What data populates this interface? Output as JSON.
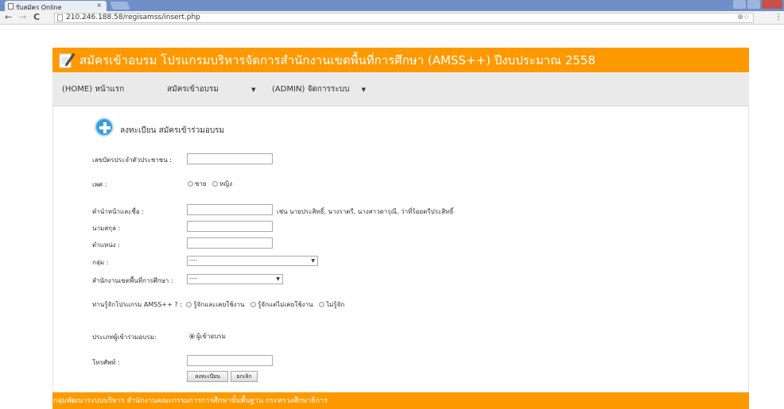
{
  "browser": {
    "tab_title": "รับสมัคร Online",
    "tab_close": "×",
    "url": "210.246.188.58/regisamss/insert.php",
    "back": "←",
    "forward": "→",
    "reload": "C",
    "zoom_star": "⊕☆",
    "menu": "⋮"
  },
  "banner": {
    "title": "สมัครเข้าอบรม โปรแกรมบริหารจัดการสำนักงานเขตพื้นที่การศึกษา (AMSS++) ปีงบประมาณ 2558"
  },
  "nav": {
    "home": "(HOME) หน้าแรก",
    "register": "สมัครเข้าอบรม",
    "admin": "(ADMIN) จัดการระบบ",
    "caret": "▼"
  },
  "form": {
    "heading": "ลงทะเบียน สมัครเข้าร่วมอบรม",
    "id_label": "เลขบัตรประจำตัวประชาชน :",
    "sex_label": "เพศ :",
    "sex_male": "ชาย",
    "sex_female": "หญิง",
    "name_label": "คำนำหน้าและชื่อ :",
    "name_hint": "เช่น นายประสิทธิ์, นางราตรี, นางสาวดารุณี, ว่าที่ร้อยตรีประสิทธิ์",
    "surname_label": "นามสกุล :",
    "position_label": "ตำแหน่ง :",
    "group_label": "กลุ่ม :",
    "group_value": "----",
    "office_label": "สำนักงานเขตพื้นที่การศึกษา :",
    "office_value": "----",
    "know_label": "ท่านรู้จักโปรแกรม AMSS++ ? :",
    "know_opt1": "รู้จักและเคยใช้งาน",
    "know_opt2": "รู้จักแต่ไม่เคยใช้งาน",
    "know_opt3": "ไม่รู้จัก",
    "type_label": "ประเภทผู้เข้าร่วมอบรม:",
    "type_opt": "ผู้เข้าอบรม",
    "phone_label": "โทรศัพท์ :",
    "submit": "ลงทะเบียน",
    "cancel": "ยกเลิก"
  },
  "footer": {
    "text": "กลุ่มพัฒนาระบบบริหาร  สำนักงานคณะกรรมการการศึกษาขั้นพื้นฐาน  กระทรวงศึกษาธิการ"
  },
  "colors": {
    "brand": "#ff9900",
    "nav_bg": "#eaeaea",
    "icon_blue": "#3b9ed8"
  }
}
